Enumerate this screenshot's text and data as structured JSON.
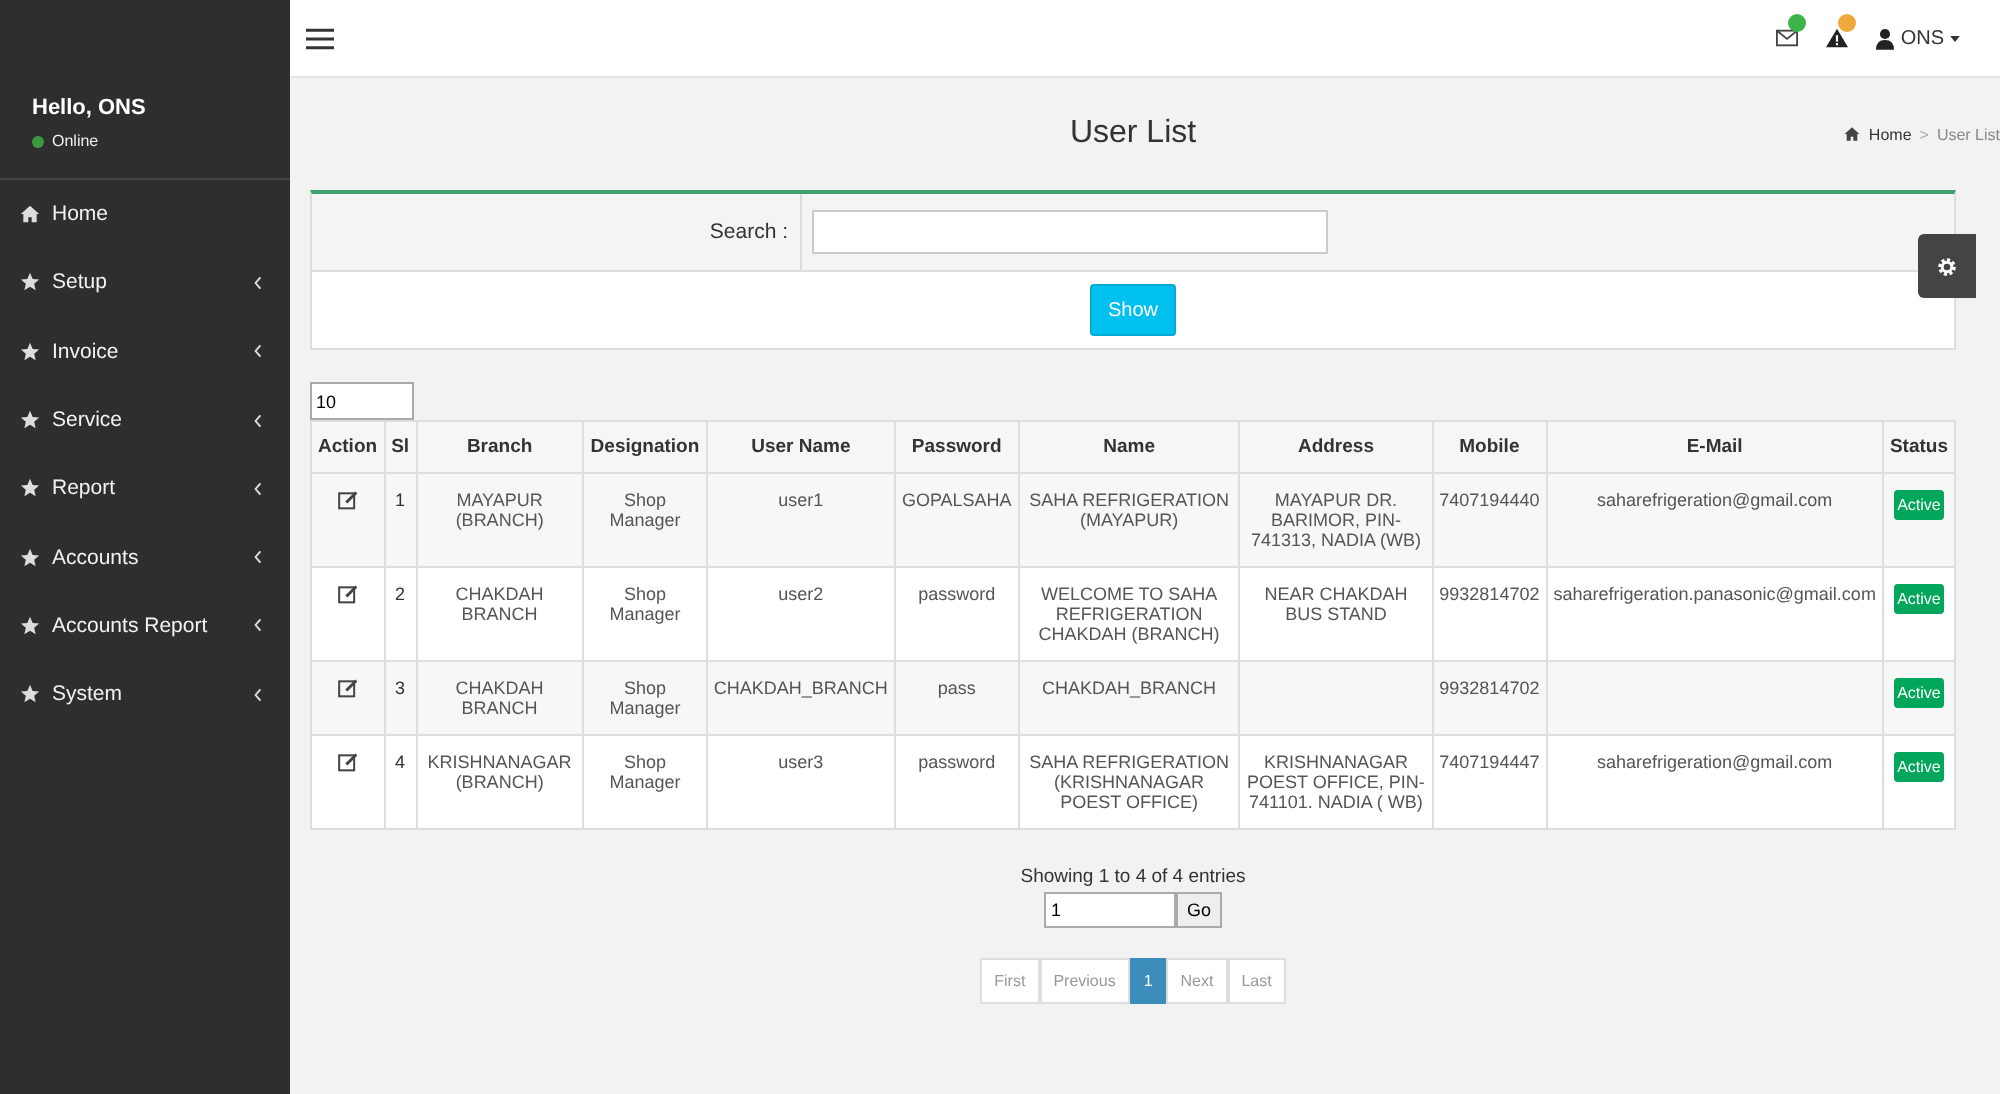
{
  "sidebar": {
    "greeting": "Hello, ONS",
    "status": "Online",
    "items": [
      {
        "label": "Home",
        "kind": "home",
        "expandable": false
      },
      {
        "label": "Setup",
        "kind": "star",
        "expandable": true
      },
      {
        "label": "Invoice",
        "kind": "star",
        "expandable": true
      },
      {
        "label": "Service",
        "kind": "star",
        "expandable": true
      },
      {
        "label": "Report",
        "kind": "star",
        "expandable": true
      },
      {
        "label": "Accounts",
        "kind": "star",
        "expandable": true
      },
      {
        "label": "Accounts Report",
        "kind": "star",
        "expandable": true
      },
      {
        "label": "System",
        "kind": "star",
        "expandable": true
      }
    ]
  },
  "topbar": {
    "notifications": [
      {
        "kind": "mail",
        "color": "#3cb44b"
      },
      {
        "kind": "warning",
        "color": "#f0a83c"
      }
    ],
    "user": "ONS"
  },
  "page": {
    "title": "User List",
    "breadcrumb": [
      "Home",
      "User List"
    ],
    "separator": ">"
  },
  "search": {
    "label": "Search :",
    "button": "Show"
  },
  "page_size": "10",
  "table": {
    "columns": [
      "Action",
      "Sl",
      "Branch",
      "Designation",
      "User Name",
      "Password",
      "Name",
      "Address",
      "Mobile",
      "E-Mail",
      "Status"
    ],
    "rows": [
      {
        "sl": "1",
        "branch": "MAYAPUR (BRANCH)",
        "designation": "Shop Manager",
        "username": "user1",
        "password": "GOPALSAHA",
        "name": "SAHA REFRIGERATION (MAYAPUR)",
        "address": "MAYAPUR DR. BARIMOR, PIN-741313, NADIA (WB)",
        "mobile": "7407194440",
        "email": "saharefrigeration@gmail.com",
        "status": "Active"
      },
      {
        "sl": "2",
        "branch": "CHAKDAH BRANCH",
        "designation": "Shop Manager",
        "username": "user2",
        "password": "password",
        "name": "WELCOME TO SAHA REFRIGERATION CHAKDAH (BRANCH)",
        "address": "NEAR CHAKDAH BUS STAND",
        "mobile": "9932814702",
        "email": "saharefrigeration.panasonic@gmail.com",
        "status": "Active"
      },
      {
        "sl": "3",
        "branch": "CHAKDAH BRANCH",
        "designation": "Shop Manager",
        "username": "CHAKDAH_BRANCH",
        "password": "pass",
        "name": "CHAKDAH_BRANCH",
        "mobile": "9932814702",
        "status": "Active"
      },
      {
        "sl": "4",
        "branch": "KRISHNANAGAR (BRANCH)",
        "designation": "Shop Manager",
        "username": "user3",
        "password": "password",
        "name": "SAHA REFRIGERATION (KRISHNANAGAR POEST OFFICE)",
        "address": "KRISHNANAGAR POEST OFFICE, PIN-741101. NADIA ( WB)",
        "mobile": "7407194447",
        "email": "saharefrigeration@gmail.com",
        "status": "Active"
      }
    ]
  },
  "footer": {
    "info": "Showing 1 to 4 of 4 entries",
    "page_value": "1",
    "go": "Go",
    "pages": [
      {
        "label": "First",
        "selected": false
      },
      {
        "label": "Previous",
        "selected": false
      },
      {
        "label": "1",
        "selected": true
      },
      {
        "label": "Next",
        "selected": false
      },
      {
        "label": "Last",
        "selected": false
      }
    ]
  }
}
